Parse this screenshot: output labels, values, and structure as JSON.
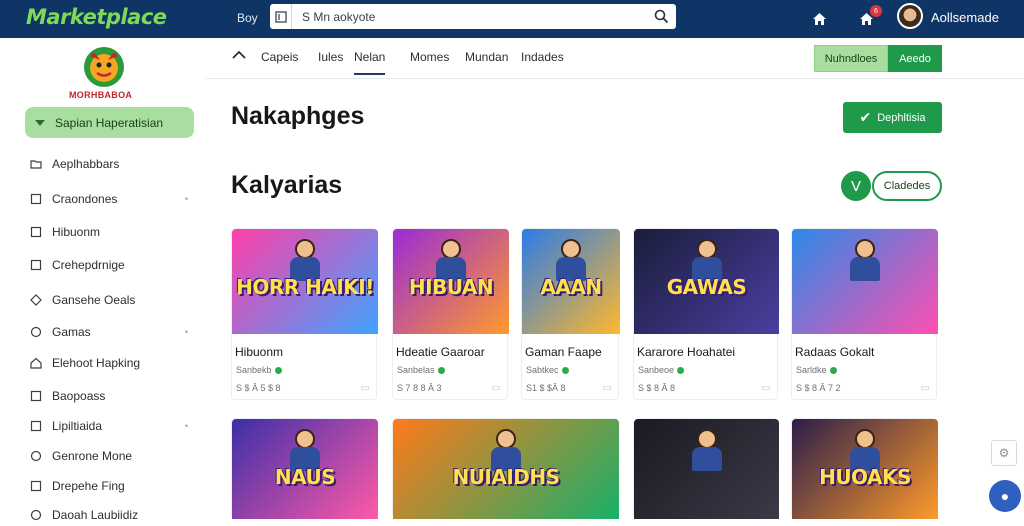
{
  "topbar": {
    "brand": "Marketplace",
    "search_prefix": "Boy",
    "search_value": "S Mn aokyote",
    "notification_count": "6",
    "user_name": "Aollsemade"
  },
  "sidebar": {
    "logo_text": "MORHBABOA",
    "active_item": "Sapian Haperatisian",
    "items": [
      {
        "label": "Aeplhabbars",
        "icon": "folder-icon",
        "chevron": false
      },
      {
        "label": "Craondones",
        "icon": "box-icon",
        "chevron": true
      },
      {
        "label": "Hibuonm",
        "icon": "box-icon",
        "chevron": false
      },
      {
        "label": "Crehepdrnige",
        "icon": "box-icon",
        "chevron": false
      },
      {
        "label": "Gansehe Oeals",
        "icon": "diamond-icon",
        "chevron": false
      },
      {
        "label": "Gamas",
        "icon": "circle-icon",
        "chevron": true
      },
      {
        "label": "Elehoot Hapking",
        "icon": "house-icon",
        "chevron": false
      },
      {
        "label": "Baopoass",
        "icon": "box-icon",
        "chevron": false
      },
      {
        "label": "Lipiltiaida",
        "icon": "box-icon",
        "chevron": true
      },
      {
        "label": "Genrone Mone",
        "icon": "circle-icon",
        "chevron": false
      },
      {
        "label": "Drepehe Fing",
        "icon": "box-icon",
        "chevron": false
      },
      {
        "label": "Daoah Laubiidiz",
        "icon": "circle-icon",
        "chevron": false
      }
    ]
  },
  "nav": {
    "tabs": [
      "Capeis",
      "Iules",
      "Nelan",
      "Momes",
      "Mundan",
      "Indades"
    ],
    "active_tab": "Nelan",
    "btn_secondary": "Nuhndloes",
    "btn_primary": "Aeedo"
  },
  "main": {
    "page_title": "Nakaphges",
    "primary_action": "Dephltisia",
    "section_title": "Kalyarias",
    "circle_btn_glyph": "V",
    "pill_btn": "Cladedes"
  },
  "cards": [
    {
      "name": "Hibuonm",
      "thumb_text": "HORR HAIKI!",
      "meta": "Sanbekb",
      "price": "S $ Â 5 $ 8",
      "c1": "#ff3fa8",
      "c2": "#3fa3ff"
    },
    {
      "name": "Hdeatie Gaaroar",
      "thumb_text": "HIBUAN",
      "meta": "Sanbelas",
      "price": "S 7 8 8 Â 3",
      "c1": "#9a2bd8",
      "c2": "#ff9a2b"
    },
    {
      "name": "Gaman Faape",
      "thumb_text": "AAAN",
      "meta": "Sabtkec",
      "price": "S1 $ $Â 8",
      "c1": "#2b7be8",
      "c2": "#ffb82b"
    },
    {
      "name": "Kararore Hoahatei",
      "thumb_text": "GAWAS",
      "meta": "Sanbeoe",
      "price": "S $ 8 Â 8",
      "c1": "#1a1d3a",
      "c2": "#4a3fa0"
    },
    {
      "name": "Radaas Gokalt",
      "thumb_text": "",
      "meta": "Sarldke",
      "price": "S $ 8 Â 7 2",
      "c1": "#2b8ae8",
      "c2": "#ff4fb0"
    },
    {
      "name": "",
      "thumb_text": "NAUS",
      "meta": "",
      "price": "",
      "c1": "#3b2fa8",
      "c2": "#ff5aa8"
    },
    {
      "name": "",
      "thumb_text": "NUIAIDHS",
      "meta": "",
      "price": "",
      "c1": "#ff7a1a",
      "c2": "#18b06a"
    },
    {
      "name": "",
      "thumb_text": "",
      "meta": "",
      "price": "",
      "c1": "#1a1a22",
      "c2": "#3a3a48"
    },
    {
      "name": "",
      "thumb_text": "HUOAKS",
      "meta": "",
      "price": "",
      "c1": "#2a1d4a",
      "c2": "#ff9a2b"
    }
  ],
  "colors": {
    "topbar": "#0f3566",
    "brand": "#7ed957",
    "accent_green": "#1e9a4a",
    "light_green": "#a8dfa0"
  }
}
